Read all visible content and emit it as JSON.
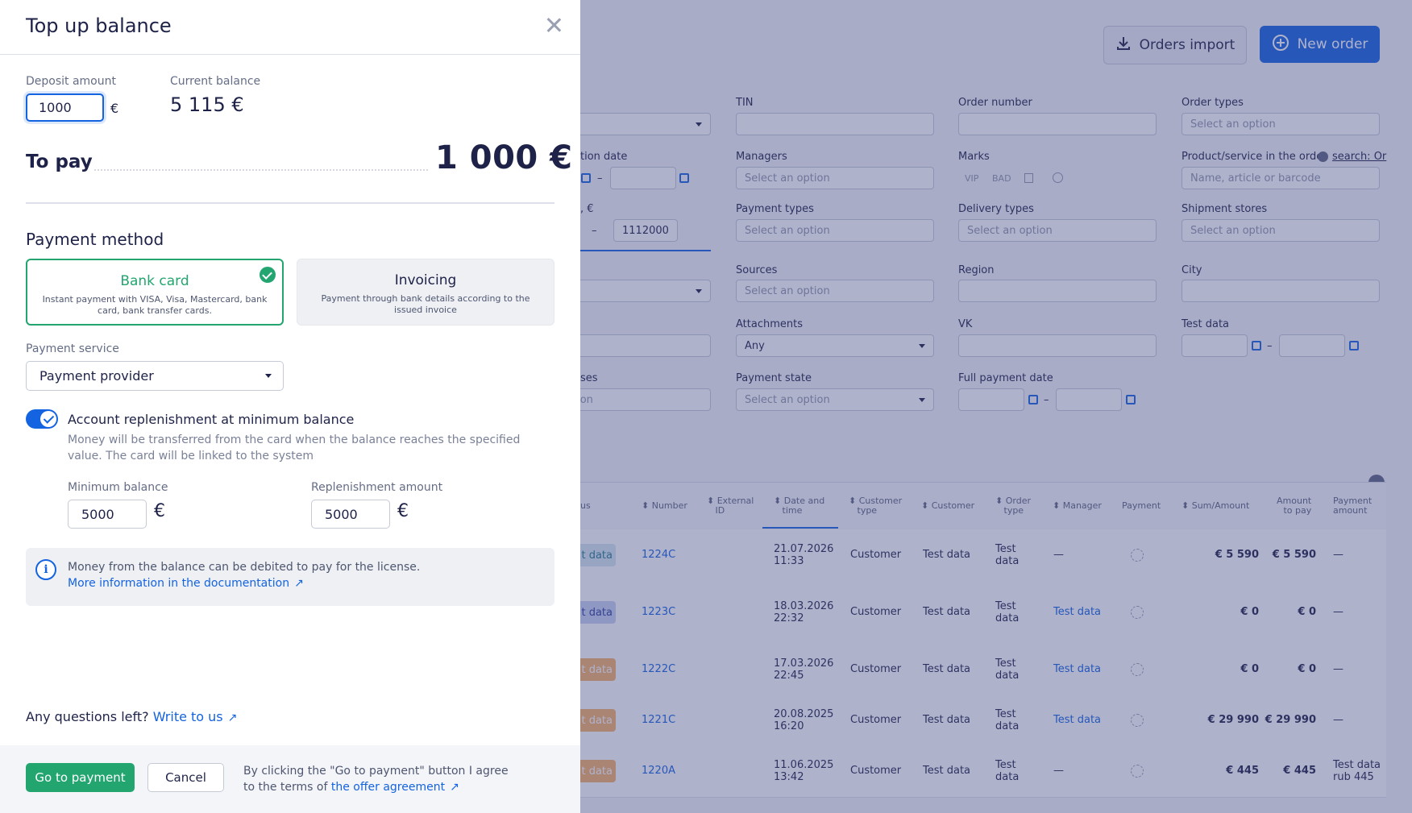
{
  "background": {
    "orders_import_label": "Orders import",
    "new_order_label": "New order",
    "filters": {
      "tin": "TIN",
      "order_number": "Order number",
      "order_types": "Order types",
      "creation_date": "tion date",
      "managers": "Managers",
      "marks": "Marks",
      "mark_vip": "VIP",
      "mark_bad": "BAD",
      "product_service": "Product/service in the order",
      "search_mode": "search: Or",
      "sum_prefix": ", €",
      "sum_to": "1112000",
      "payment_types": "Payment types",
      "delivery_types": "Delivery types",
      "shipment_stores": "Shipment stores",
      "sources": "Sources",
      "region": "Region",
      "city": "City",
      "attachments": "Attachments",
      "attachments_value": "Any",
      "vk": "VK",
      "test_data": "Test data",
      "statuses": "ses",
      "statuses_placeholder": "tion",
      "payment_state": "Payment state",
      "full_payment_date": "Full payment date",
      "select_placeholder": "Select an option",
      "product_placeholder": "Name, article or barcode"
    },
    "table": {
      "headers": {
        "status": "us",
        "number": "Number",
        "external_id_1": "External",
        "external_id_2": "ID",
        "date_1": "Date and",
        "date_2": "time",
        "customer_type_1": "Customer",
        "customer_type_2": "type",
        "customer": "Customer",
        "order_type_1": "Order",
        "order_type_2": "type",
        "manager": "Manager",
        "payment": "Payment",
        "sum": "Sum/Amount",
        "to_pay_1": "Amount",
        "to_pay_2": "to pay",
        "payment_amount_1": "Payment",
        "payment_amount_2": "amount"
      },
      "rows": [
        {
          "status": "t data",
          "status_color": "#d6e9f0",
          "status_text": "#2b7a91",
          "number": "1224C",
          "date": "21.07.2026",
          "time": "11:33",
          "customer_type": "Customer",
          "customer": "Test data",
          "order_type_1": "Test",
          "order_type_2": "data",
          "manager": "—",
          "sum": "€ 5 590",
          "to_pay": "€ 5 590",
          "payment_amount_1": "—",
          "payment_amount_2": ""
        },
        {
          "status": "t data",
          "status_color": "#c8d0f2",
          "status_text": "#2e3e9e",
          "number": "1223C",
          "date": "18.03.2026",
          "time": "22:32",
          "customer_type": "Customer",
          "customer": "Test data",
          "order_type_1": "Test",
          "order_type_2": "data",
          "manager": "Test data",
          "sum": "€ 0",
          "to_pay": "€ 0",
          "payment_amount_1": "—",
          "payment_amount_2": ""
        },
        {
          "status": "t data",
          "status_color": "#f7b26a",
          "status_text": "#ffffff",
          "number": "1222C",
          "date": "17.03.2026",
          "time": "22:45",
          "customer_type": "Customer",
          "customer": "Test data",
          "order_type_1": "Test",
          "order_type_2": "data",
          "manager": "Test data",
          "sum": "€ 0",
          "to_pay": "€ 0",
          "payment_amount_1": "—",
          "payment_amount_2": ""
        },
        {
          "status": "t data",
          "status_color": "#f7b26a",
          "status_text": "#ffffff",
          "number": "1221C",
          "date": "20.08.2025",
          "time": "16:20",
          "customer_type": "Customer",
          "customer": "Test data",
          "order_type_1": "Test",
          "order_type_2": "data",
          "manager": "Test data",
          "sum": "€ 29 990",
          "to_pay": "€ 29 990",
          "payment_amount_1": "—",
          "payment_amount_2": ""
        },
        {
          "status": "t data",
          "status_color": "#f7b26a",
          "status_text": "#ffffff",
          "number": "1220A",
          "date": "11.06.2025",
          "time": "13:42",
          "customer_type": "Customer",
          "customer": "Test data",
          "order_type_1": "Test",
          "order_type_2": "data",
          "manager": "—",
          "sum": "€ 445",
          "to_pay": "€ 445",
          "payment_amount_1": "Test data",
          "payment_amount_2": "rub 445"
        }
      ]
    }
  },
  "modal": {
    "title": "Top up balance",
    "deposit_label": "Deposit amount",
    "deposit_value": "1000",
    "deposit_currency": "€",
    "current_balance_label": "Current balance",
    "current_balance_value": "5 115 €",
    "to_pay_label": "To pay",
    "to_pay_value": "1 000 €",
    "payment_method_title": "Payment method",
    "methods": [
      {
        "title": "Bank card",
        "desc": "Instant payment with VISA, Visa, Mastercard, bank card, bank transfer cards.",
        "selected": true
      },
      {
        "title": "Invoicing",
        "desc": "Payment through bank details according to the issued invoice",
        "selected": false
      }
    ],
    "payment_service_label": "Payment service",
    "payment_service_value": "Payment provider",
    "auto_replenish_label": "Account replenishment at minimum balance",
    "auto_replenish_enabled": true,
    "auto_replenish_desc": "Money will be transferred from the card when the balance reaches the specified value. The card will be linked to the system",
    "min_balance_label": "Minimum balance",
    "min_balance_value": "5000",
    "replenish_amount_label": "Replenishment amount",
    "replenish_amount_value": "5000",
    "currency_symbol": "€",
    "info_text": "Money from the balance can be debited to pay for the license.",
    "info_link": "More information in the documentation",
    "questions_text": "Any questions left?",
    "questions_link": "Write to us",
    "go_button": "Go to payment",
    "cancel_button": "Cancel",
    "agree_text": "By clicking the \"Go to payment\" button I agree to the terms of",
    "agree_link": "the offer agreement"
  },
  "colors": {
    "accent_blue": "#1463e0",
    "accent_green": "#23a56f",
    "overlay": "#404882"
  },
  "icons": [
    "download-icon",
    "plus-circle-icon",
    "close-icon",
    "check-icon",
    "chevron-down-icon",
    "info-icon",
    "external-link-icon",
    "calendar-icon",
    "clock-icon",
    "gear-icon",
    "sort-icon"
  ]
}
